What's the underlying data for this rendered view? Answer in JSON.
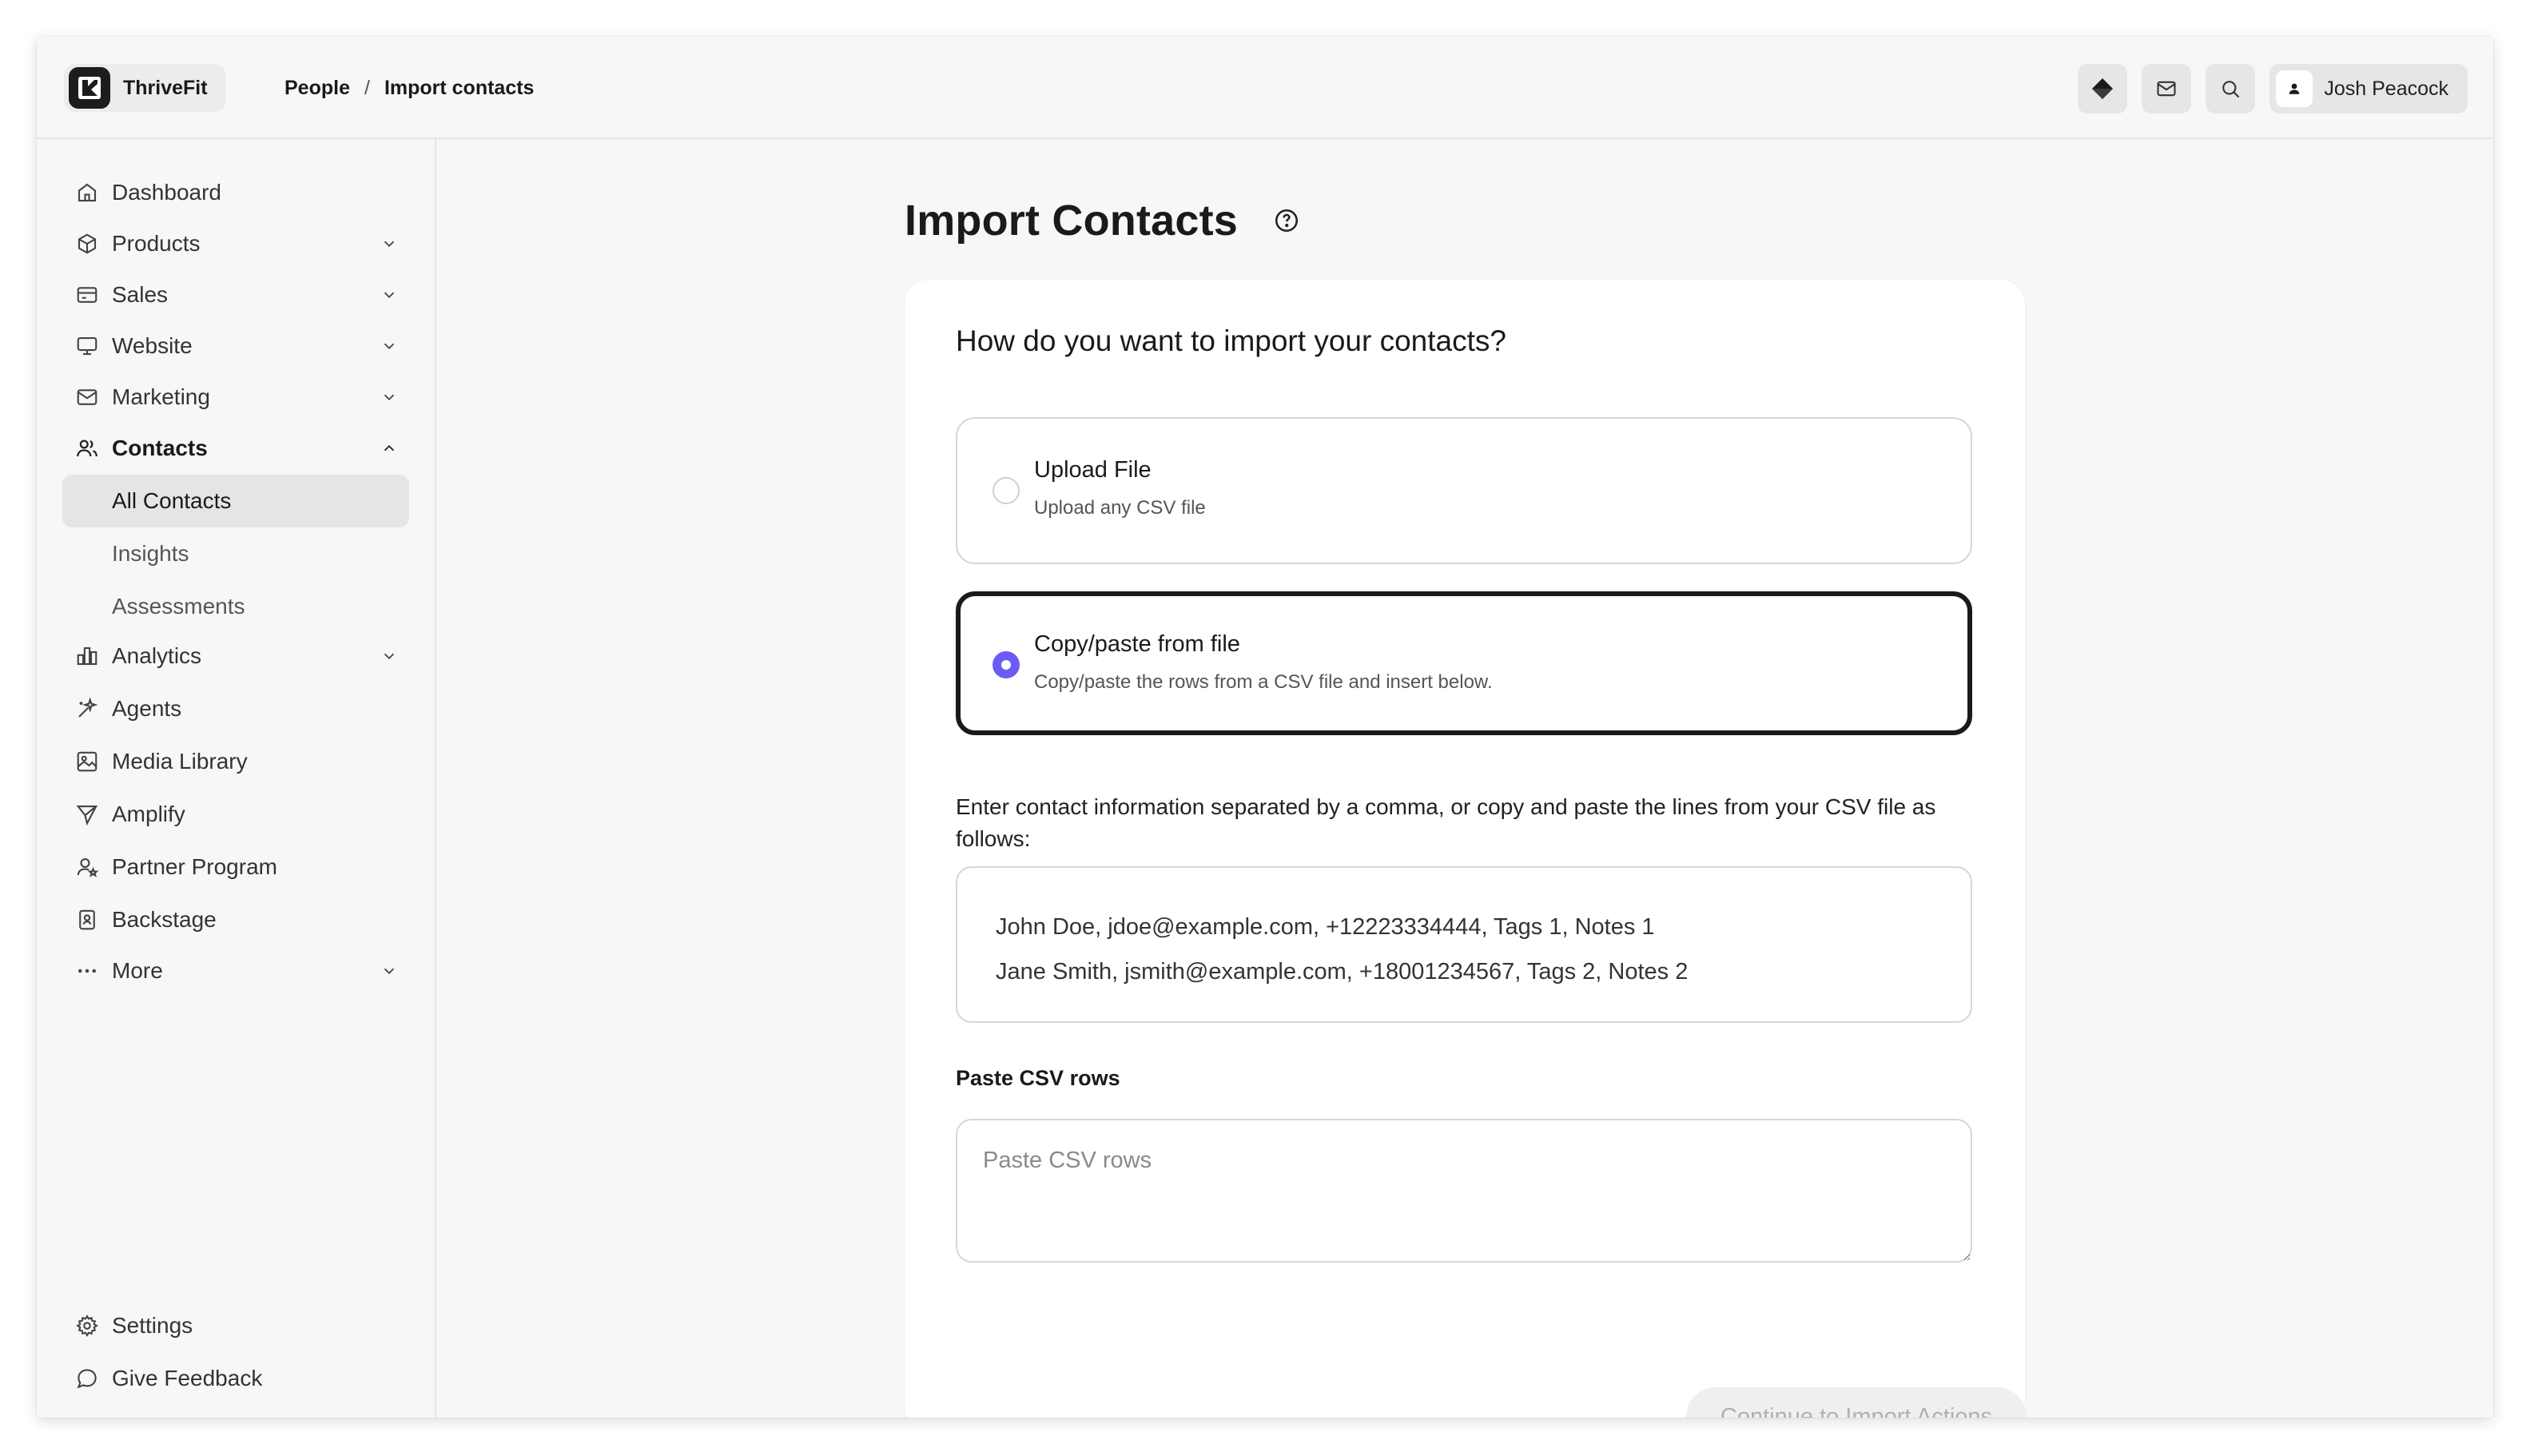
{
  "app": {
    "name": "ThriveFit"
  },
  "breadcrumb": {
    "parent": "People",
    "separator": "/",
    "current": "Import contacts"
  },
  "user": {
    "name": "Josh Peacock"
  },
  "sidebar": {
    "items": [
      {
        "label": "Dashboard",
        "icon": "home-icon"
      },
      {
        "label": "Products",
        "icon": "box-icon"
      },
      {
        "label": "Sales",
        "icon": "credit-card-icon"
      },
      {
        "label": "Website",
        "icon": "monitor-icon"
      },
      {
        "label": "Marketing",
        "icon": "mail-icon"
      },
      {
        "label": "Contacts",
        "icon": "users-icon"
      },
      {
        "label": "All Contacts"
      },
      {
        "label": "Insights"
      },
      {
        "label": "Assessments"
      },
      {
        "label": "Analytics",
        "icon": "bar-chart-icon"
      },
      {
        "label": "Agents",
        "icon": "sparkle-icon"
      },
      {
        "label": "Media Library",
        "icon": "image-icon"
      },
      {
        "label": "Amplify",
        "icon": "send-icon"
      },
      {
        "label": "Partner Program",
        "icon": "user-star-icon"
      },
      {
        "label": "Backstage",
        "icon": "badge-icon"
      },
      {
        "label": "More",
        "icon": "dots-icon"
      }
    ],
    "footer": [
      {
        "label": "Settings",
        "icon": "gear-icon"
      },
      {
        "label": "Give Feedback",
        "icon": "chat-icon"
      }
    ]
  },
  "main": {
    "title": "Import Contacts",
    "question": "How do you want to import your contacts?",
    "options": [
      {
        "title": "Upload File",
        "subtitle": "Upload any CSV file",
        "selected": false
      },
      {
        "title": "Copy/paste from file",
        "subtitle": "Copy/paste the rows from a CSV file and insert below.",
        "selected": true
      }
    ],
    "instructions": "Enter contact information separated by a comma, or copy and paste the lines from your CSV file as follows:",
    "example_lines": [
      "John Doe, jdoe@example.com, +12223334444, Tags 1, Notes 1",
      "Jane Smith, jsmith@example.com, +18001234567, Tags 2, Notes 2"
    ],
    "paste_label": "Paste CSV rows",
    "paste_placeholder": "Paste CSV rows",
    "paste_value": "",
    "continue_label": "Continue to Import Actions"
  },
  "colors": {
    "accent": "#6b5cf6",
    "selected_border": "#1a1a1a",
    "disabled_text": "#b0b0b0"
  }
}
